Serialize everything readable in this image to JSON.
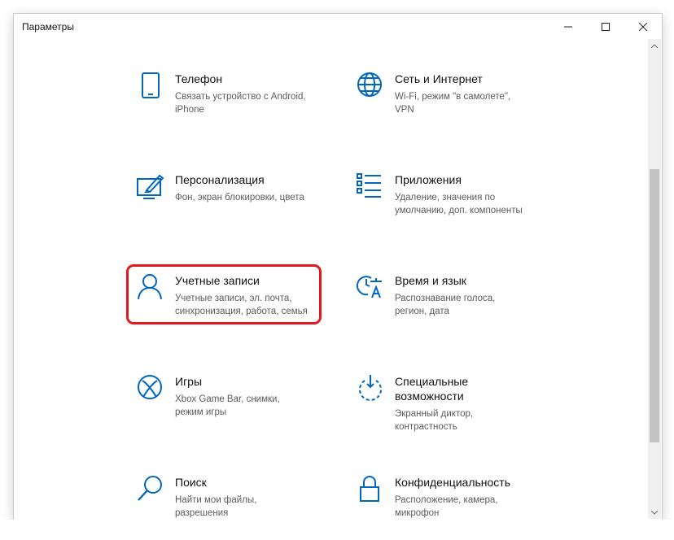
{
  "window": {
    "title": "Параметры",
    "controls": {
      "minimize_icon": "minimize-icon",
      "maximize_icon": "maximize-icon",
      "close_icon": "close-icon"
    }
  },
  "accent_color": "#0067c0",
  "highlight_color": "#e0191e",
  "categories": [
    {
      "icon": "phone-icon",
      "name": "Телефон",
      "desc1": "Связать устройство с Android,",
      "desc2": "iPhone"
    },
    {
      "icon": "globe-icon",
      "name": "Сеть и Интернет",
      "desc1": "Wi-Fi, режим \"в самолете\",",
      "desc2": "VPN"
    },
    {
      "icon": "personalization-icon",
      "name": "Персонализация",
      "desc1": "Фон, экран блокировки, цвета",
      "desc2": ""
    },
    {
      "icon": "apps-list-icon",
      "name": "Приложения",
      "desc1": "Удаление, значения по",
      "desc2": "умолчанию, доп. компоненты"
    },
    {
      "icon": "person-icon",
      "name": "Учетные записи",
      "desc1": "Учетные записи, эл. почта,",
      "desc2": "синхронизация, работа, семья"
    },
    {
      "icon": "time-language-icon",
      "name": "Время и язык",
      "desc1": "Распознавание голоса,",
      "desc2": "регион, дата"
    },
    {
      "icon": "xbox-icon",
      "name": "Игры",
      "desc1": "Xbox Game Bar, снимки,",
      "desc2": "режим игры"
    },
    {
      "icon": "accessibility-icon",
      "name": "Специальные",
      "name2": "возможности",
      "desc1": "Экранный диктор,",
      "desc2": "контрастность"
    },
    {
      "icon": "search-icon",
      "name": "Поиск",
      "desc1": "Найти мои файлы,",
      "desc2": "разрешения"
    },
    {
      "icon": "lock-icon",
      "name": "Конфиденциальность",
      "desc1": "Расположение, камера,",
      "desc2": "микрофон"
    }
  ]
}
